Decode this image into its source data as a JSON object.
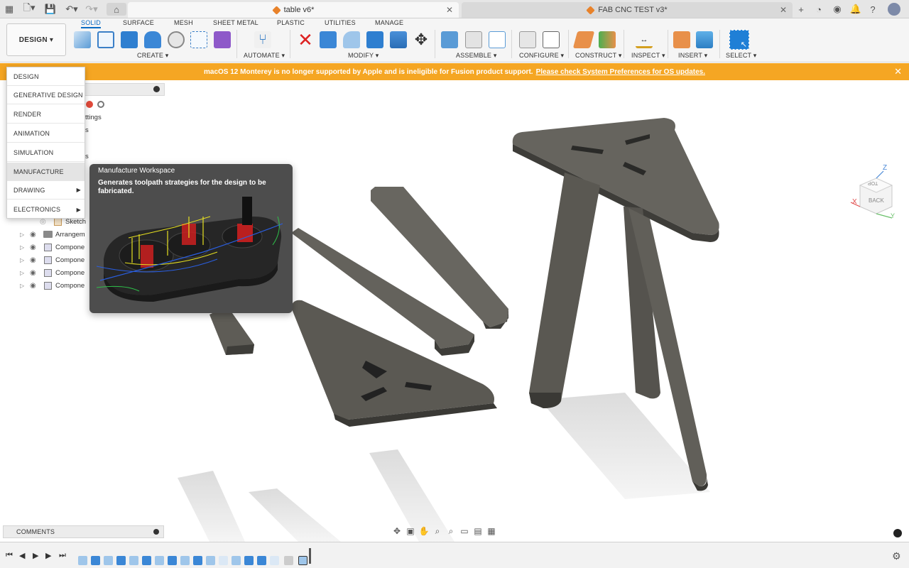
{
  "tabs": {
    "active_doc": "table v6*",
    "inactive_doc": "FAB CNC TEST v3*"
  },
  "ribbon": {
    "workspace_button": "DESIGN ▾",
    "tabs": [
      "SOLID",
      "SURFACE",
      "MESH",
      "SHEET METAL",
      "PLASTIC",
      "UTILITIES",
      "MANAGE"
    ],
    "groups": [
      "CREATE ▾",
      "AUTOMATE ▾",
      "MODIFY ▾",
      "ASSEMBLE ▾",
      "CONFIGURE ▾",
      "CONSTRUCT ▾",
      "INSPECT ▾",
      "INSERT ▾",
      "SELECT ▾"
    ]
  },
  "banner": {
    "message": "macOS 12 Monterey is no longer supported by Apple and is ineligible for Fusion product support.",
    "link": "Please check System Preferences for OS updates."
  },
  "workspace_menu": {
    "items": [
      "DESIGN",
      "GENERATIVE DESIGN",
      "RENDER",
      "ANIMATION",
      "SIMULATION",
      "MANUFACTURE",
      "DRAWING",
      "ELECTRONICS"
    ],
    "highlighted": "MANUFACTURE"
  },
  "tooltip": {
    "title": "Manufacture Workspace",
    "description": "Generates toolpath strategies for the design to be fabricated."
  },
  "browser": {
    "fragments": [
      "ttings",
      "s",
      "s",
      "ch",
      "ch",
      "ch",
      "ch"
    ],
    "rows": [
      {
        "label": "Sketch",
        "type": "sketch"
      },
      {
        "label": "Arrangem",
        "type": "folder"
      },
      {
        "label": "Compone",
        "type": "component"
      },
      {
        "label": "Compone",
        "type": "component"
      },
      {
        "label": "Compone",
        "type": "component"
      },
      {
        "label": "Compone",
        "type": "component"
      }
    ]
  },
  "comments": {
    "label": "COMMENTS"
  },
  "viewcube": {
    "face_label": "BACK",
    "top_label": "TOP",
    "axis_x": "X",
    "axis_y": "Y",
    "axis_z": "Z"
  },
  "colors": {
    "accent": "#0b6cc4",
    "banner": "#f5a623",
    "part": "#5e5c56",
    "tooltip_bg": "#4d4d4d"
  }
}
